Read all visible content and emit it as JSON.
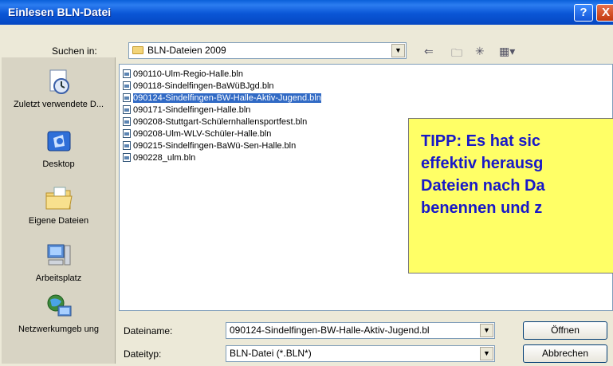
{
  "window": {
    "title": "Einlesen BLN-Datei",
    "help_label": "?",
    "close_label": "X"
  },
  "lookin": {
    "label": "Suchen in:",
    "value": "BLN-Dateien 2009"
  },
  "places": [
    {
      "id": "recent",
      "label": "Zuletzt verwendete D..."
    },
    {
      "id": "desktop",
      "label": "Desktop"
    },
    {
      "id": "mydocs",
      "label": "Eigene Dateien"
    },
    {
      "id": "mycomputer",
      "label": "Arbeitsplatz"
    },
    {
      "id": "network",
      "label": "Netzwerkumgeb ung"
    }
  ],
  "files": [
    "090110-Ulm-Regio-Halle.bln",
    "090118-Sindelfingen-BaWüBJgd.bln",
    "090124-Sindelfingen-BW-Halle-Aktiv-Jugend.bln",
    "090171-Sindelfingen-Halle.bln",
    "090208-Stuttgart-Schülernhallensportfest.bln",
    "090208-Ulm-WLV-Schüler-Halle.bln",
    "090215-Sindelfingen-BaWü-Sen-Halle.bln",
    "090228_ulm.bln"
  ],
  "selected_file_index": 2,
  "tip": {
    "lines": [
      "TIPP: Es hat sic",
      "effektiv herausg",
      "Dateien nach Da",
      "benennen und z"
    ]
  },
  "filename": {
    "label": "Dateiname:",
    "value": "090124-Sindelfingen-BW-Halle-Aktiv-Jugend.bl"
  },
  "filetype": {
    "label": "Dateityp:",
    "value": "BLN-Datei (*.BLN*)"
  },
  "buttons": {
    "open": "Öffnen",
    "cancel": "Abbrechen"
  },
  "colors": {
    "titlebar": "#0a56d6",
    "selection": "#316ac5",
    "tip_background": "#ffff66",
    "tip_text": "#1818c8"
  }
}
